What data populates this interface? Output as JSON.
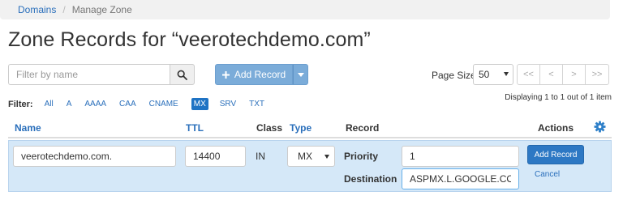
{
  "breadcrumb": {
    "items": [
      "Domains",
      "Manage Zone"
    ],
    "separator": "/"
  },
  "title": "Zone Records for “veerotechdemo.com”",
  "search": {
    "placeholder": "Filter by name",
    "value": "",
    "icon": "search-icon"
  },
  "add_record": {
    "label": "Add Record",
    "icon": "plus-icon"
  },
  "pagination": {
    "label": "Page Size",
    "page_size": "50",
    "buttons": [
      "<<",
      "<",
      ">",
      ">>"
    ],
    "summary": "Displaying 1 to 1 out of 1 item"
  },
  "filter": {
    "label": "Filter:",
    "types": [
      "All",
      "A",
      "AAAA",
      "CAA",
      "CNAME",
      "MX",
      "SRV",
      "TXT"
    ],
    "active": "MX"
  },
  "columns": {
    "name": "Name",
    "ttl": "TTL",
    "class": "Class",
    "type": "Type",
    "record": "Record",
    "actions": "Actions",
    "settings_icon": "gear-icon"
  },
  "edit_row": {
    "name": "veerotechdemo.com.",
    "ttl": "14400",
    "class": "IN",
    "type": "MX",
    "priority_label": "Priority",
    "priority": "1",
    "destination_label": "Destination",
    "destination": "ASPMX.L.GOOGLE.COM",
    "submit_label": "Add Record",
    "cancel_label": "Cancel"
  },
  "colors": {
    "link": "#2a6fbb",
    "primary": "#2d78c4",
    "add_button": "#7bacd9",
    "edit_row_bg": "#d5e8f8",
    "active_filter": "#1f73c4"
  }
}
